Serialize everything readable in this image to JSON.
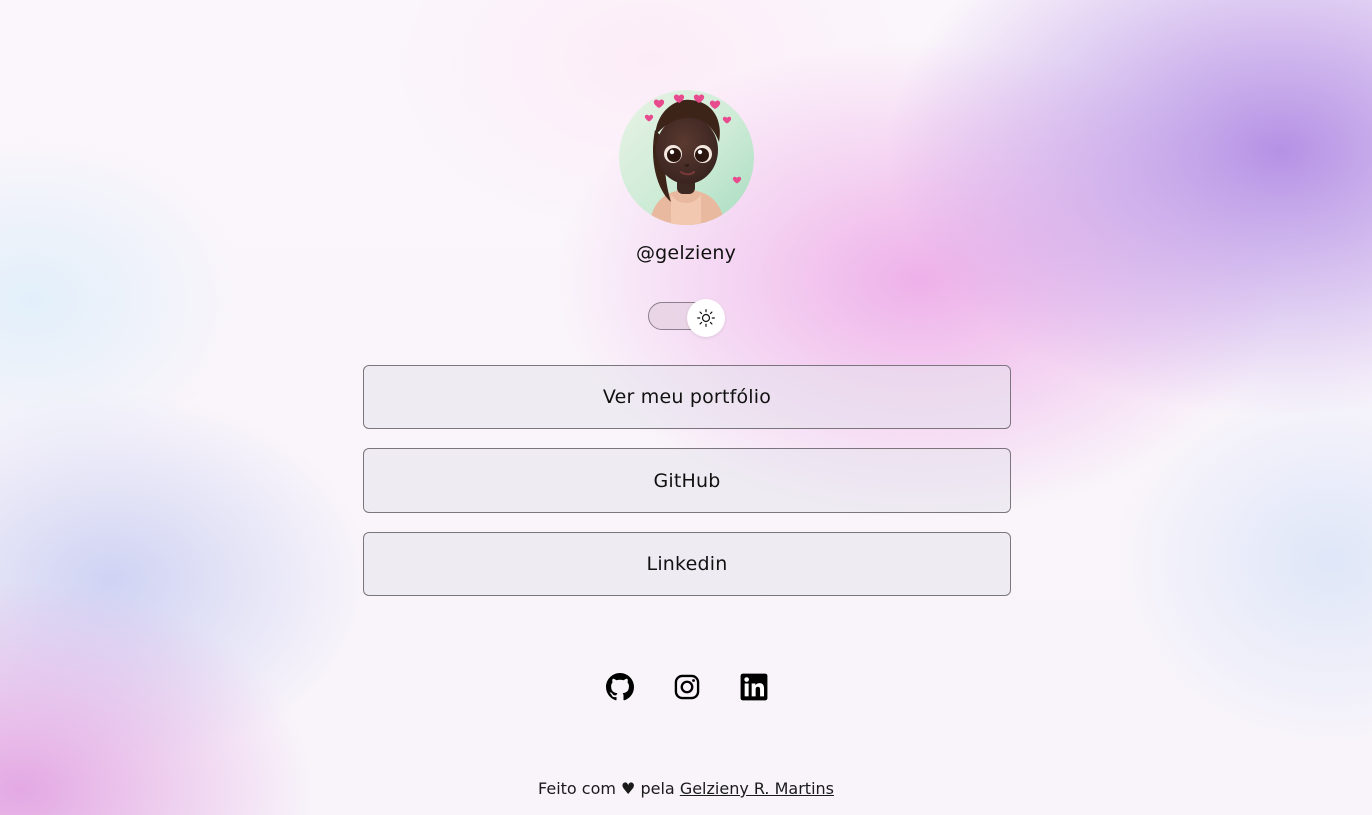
{
  "profile": {
    "handle": "@gelzieny"
  },
  "theme_toggle": {
    "icon": "sun-icon",
    "state": "light"
  },
  "links": [
    {
      "label": "Ver meu portfólio"
    },
    {
      "label": "GitHub"
    },
    {
      "label": "Linkedin"
    }
  ],
  "social": [
    {
      "icon": "github-icon"
    },
    {
      "icon": "instagram-icon"
    },
    {
      "icon": "linkedin-icon"
    }
  ],
  "footer": {
    "text": "Feito com ♥ pela",
    "author": "Gelzieny R. Martins"
  },
  "colors": {
    "accent_purple": "#b28ce4",
    "accent_pink": "#eca5e6",
    "text": "#111111"
  }
}
